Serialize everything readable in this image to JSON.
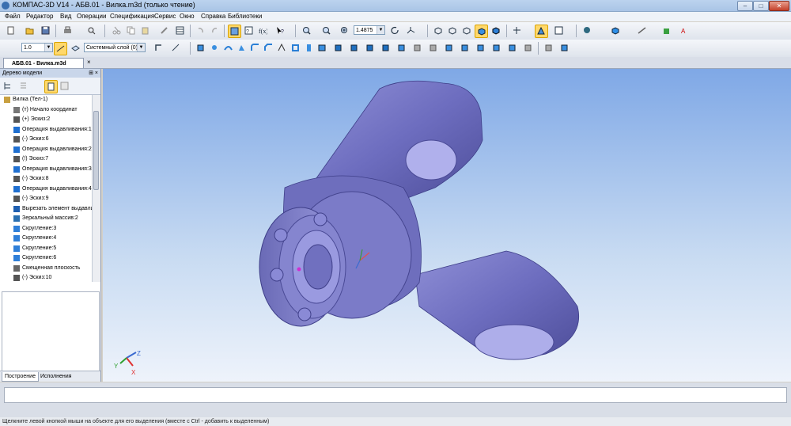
{
  "window": {
    "title": "КОМПАС-3D V14 - АБВ.01 - Вилка.m3d (только чтение)",
    "buttons": {
      "minimize": "–",
      "maximize": "□",
      "close": "✕"
    }
  },
  "menu": [
    "Файл",
    "Редактор",
    "Вид",
    "Операции",
    "Спецификация",
    "Сервис",
    "Окно",
    "Справка",
    "Библиотеки"
  ],
  "toolbar": {
    "zoom_value": "1.4875",
    "line_scale": "1.0",
    "layer_value": "Системный слой (0)"
  },
  "document_tab": {
    "label": "АБВ.01 - Вилка.m3d",
    "close": "×"
  },
  "model_tree": {
    "title": "Дерево модели",
    "pin": "⊞ ×",
    "items": [
      {
        "label": "Вилка (Тел-1)",
        "icon": "part-icon",
        "indent": 0
      },
      {
        "label": "(т) Начало координат",
        "icon": "origin-icon",
        "indent": 1
      },
      {
        "label": "(+) Эскиз:2",
        "icon": "sketch-icon",
        "indent": 1
      },
      {
        "label": "Операция выдавливания:1",
        "icon": "extrude-icon",
        "indent": 1
      },
      {
        "label": "(-) Эскиз:6",
        "icon": "sketch-icon",
        "indent": 1
      },
      {
        "label": "Операция выдавливания:2",
        "icon": "extrude-icon",
        "indent": 1
      },
      {
        "label": "(!) Эскиз:7",
        "icon": "sketch-icon",
        "indent": 1
      },
      {
        "label": "Операция выдавливания:3",
        "icon": "extrude-icon",
        "indent": 1
      },
      {
        "label": "(-) Эскиз:8",
        "icon": "sketch-icon",
        "indent": 1
      },
      {
        "label": "Операция выдавливания:4",
        "icon": "extrude-icon",
        "indent": 1
      },
      {
        "label": "(-) Эскиз:9",
        "icon": "sketch-icon",
        "indent": 1
      },
      {
        "label": "Вырезать элемент выдавливания",
        "icon": "cut-icon",
        "indent": 1
      },
      {
        "label": "Зеркальный массив:2",
        "icon": "mirror-icon",
        "indent": 1
      },
      {
        "label": "Скругление:3",
        "icon": "fillet-icon",
        "indent": 1
      },
      {
        "label": "Скругление:4",
        "icon": "fillet-icon",
        "indent": 1
      },
      {
        "label": "Скругление:5",
        "icon": "fillet-icon",
        "indent": 1
      },
      {
        "label": "Скругление:6",
        "icon": "fillet-icon",
        "indent": 1
      },
      {
        "label": "Смещенная плоскость",
        "icon": "plane-icon",
        "indent": 1
      },
      {
        "label": "(-) Эскиз:10",
        "icon": "sketch-icon",
        "indent": 1
      }
    ],
    "tabs": [
      "Построение",
      "Исполнения"
    ]
  },
  "axes": {
    "x": "X",
    "y": "Y",
    "z": "Z"
  },
  "statusbar": {
    "text": "Щелкните левой кнопкой мыши на объекте для его выделения (вместе с Ctrl - добавить к выделенным)"
  }
}
